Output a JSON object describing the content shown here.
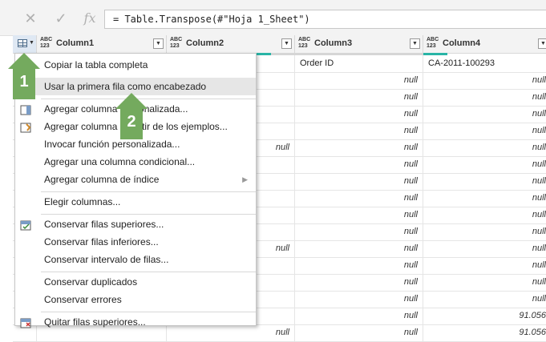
{
  "formula_bar": {
    "cancel_icon": "x-icon",
    "accept_icon": "check-icon",
    "fx_label": "fx",
    "formula": "= Table.Transpose(#\"Hoja 1_Sheet\")"
  },
  "columns": [
    {
      "type": "ABC\n123",
      "name": "Column1"
    },
    {
      "type": "ABC\n123",
      "name": "Column2"
    },
    {
      "type": "ABC\n123",
      "name": "Column3"
    },
    {
      "type": "ABC\n123",
      "name": "Column4"
    }
  ],
  "rows": [
    [
      "",
      "",
      "Order ID",
      "CA-2011-100293"
    ],
    [
      "",
      "",
      "null",
      "null"
    ],
    [
      "",
      "",
      "null",
      "null"
    ],
    [
      "",
      "",
      "null",
      "null"
    ],
    [
      "",
      "",
      "null",
      "null"
    ],
    [
      "",
      "null",
      "null",
      "null"
    ],
    [
      "",
      "",
      "null",
      "null"
    ],
    [
      "",
      "",
      "null",
      "null"
    ],
    [
      "",
      "",
      "null",
      "null"
    ],
    [
      "",
      "",
      "null",
      "null"
    ],
    [
      "",
      "",
      "null",
      "null"
    ],
    [
      "",
      "null",
      "null",
      "null"
    ],
    [
      "",
      "",
      "null",
      "null"
    ],
    [
      "",
      "",
      "null",
      "null"
    ],
    [
      "",
      "",
      "null",
      "null"
    ],
    [
      "",
      "",
      "null",
      "91.056"
    ],
    [
      "",
      "null",
      "null",
      "91.056"
    ]
  ],
  "menu": {
    "items": [
      {
        "label": "Copiar la tabla completa",
        "icon": "copy-icon"
      },
      {
        "label": "Usar la primera fila como encabezado",
        "icon": "header-row-icon"
      },
      {
        "label": "Agregar columna personalizada...",
        "icon": "custom-column-icon"
      },
      {
        "label": "Agregar columna a partir de los ejemplos...",
        "icon": "column-from-examples-icon"
      },
      {
        "label": "Invocar función personalizada...",
        "icon": ""
      },
      {
        "label": "Agregar una columna condicional...",
        "icon": ""
      },
      {
        "label": "Agregar columna de índice",
        "icon": ""
      },
      {
        "label": "Elegir columnas...",
        "icon": ""
      },
      {
        "label": "Conservar filas superiores...",
        "icon": "keep-rows-icon"
      },
      {
        "label": "Conservar filas inferiores...",
        "icon": ""
      },
      {
        "label": "Conservar intervalo de filas...",
        "icon": ""
      },
      {
        "label": "Conservar duplicados",
        "icon": ""
      },
      {
        "label": "Conservar errores",
        "icon": ""
      },
      {
        "label": "Quitar filas superiores...",
        "icon": "remove-rows-icon"
      }
    ]
  },
  "callouts": {
    "one": "1",
    "two": "2"
  }
}
